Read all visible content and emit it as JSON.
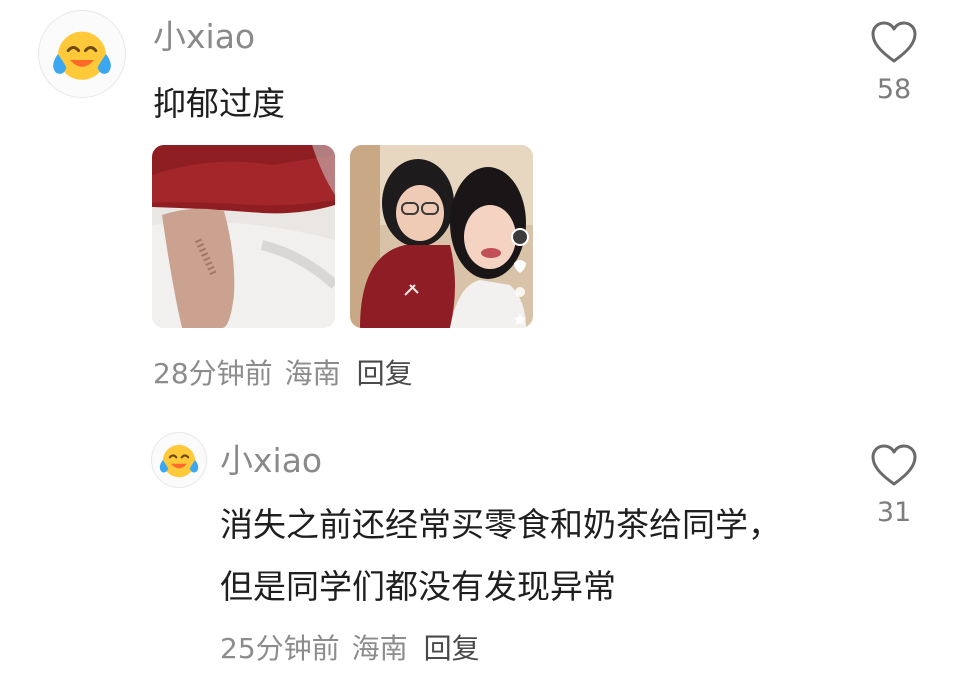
{
  "comments": [
    {
      "username": "小xiao",
      "avatar_icon": "crying-laughing-emoji-icon",
      "text": "抑郁过度",
      "images": [
        {
          "name": "arm-photo-image"
        },
        {
          "name": "two-girls-selfie-image"
        }
      ],
      "time": "28分钟前",
      "location": "海南",
      "reply_label": "回复",
      "like_icon": "heart-outline-icon",
      "likes": "58"
    },
    {
      "username": "小xiao",
      "avatar_icon": "crying-laughing-emoji-icon",
      "text": "消失之前还经常买零食和奶茶给同学，但是同学们都没有发现异常",
      "time": "25分钟前",
      "location": "海南",
      "reply_label": "回复",
      "like_icon": "heart-outline-icon",
      "likes": "31"
    }
  ],
  "colors": {
    "username": "#8a8a8a",
    "text": "#1f1f1f",
    "meta": "#8c8c8c",
    "reply": "#4a4a4a",
    "emoji_face": "#ffc93a",
    "emoji_tears": "#3aa7f0",
    "emoji_mouth": "#ff6a2b"
  }
}
